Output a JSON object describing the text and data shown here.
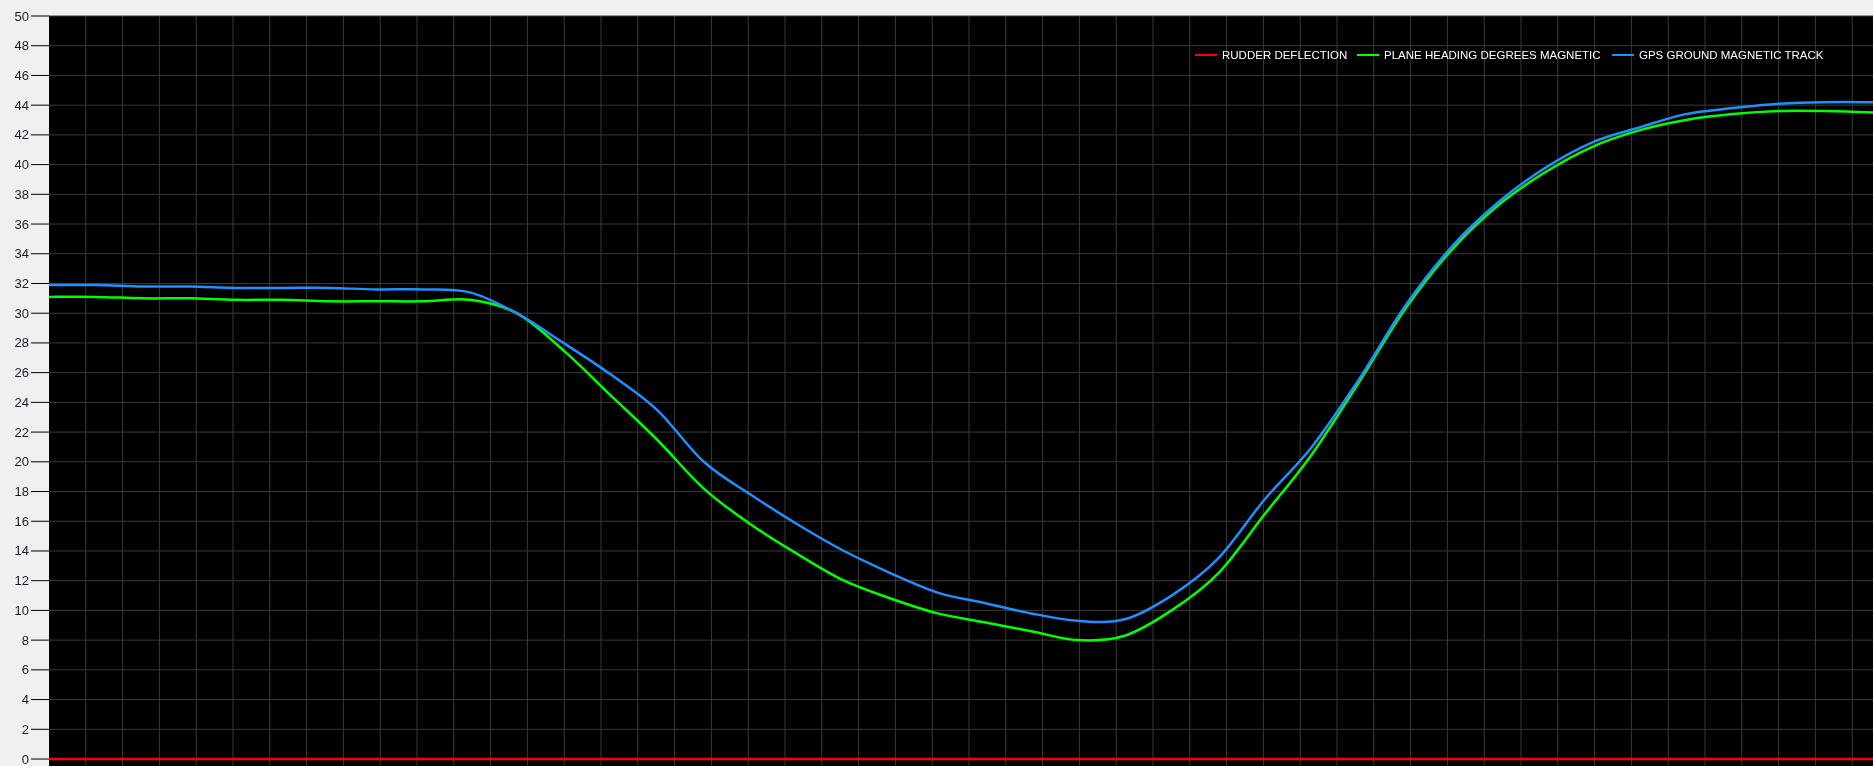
{
  "chart": {
    "chart_data": {
      "type": "line",
      "grid": true,
      "legend": true,
      "ylim": [
        -0.47,
        50
      ],
      "yticks": [
        0,
        2,
        4,
        6,
        8,
        10,
        12,
        14,
        16,
        18,
        20,
        22,
        24,
        26,
        28,
        30,
        32,
        34,
        36,
        38,
        40,
        42,
        44,
        46,
        48,
        50
      ],
      "series": [
        {
          "name": "RUDDER DEFLECTION",
          "color": "#ff0000",
          "values": [
            0,
            0,
            0,
            0,
            0,
            0,
            0,
            0,
            0,
            0,
            0,
            0,
            0,
            0,
            0,
            0,
            0,
            0,
            0,
            0,
            0,
            0,
            0,
            0,
            0,
            0,
            0,
            0,
            0,
            0,
            0,
            0,
            0,
            0,
            0,
            0,
            0,
            0,
            0,
            0
          ]
        },
        {
          "name": "PLANE HEADING DEGREES MAGNETIC",
          "color": "#00ff00",
          "values": [
            31.1,
            31.1,
            31.0,
            31.0,
            30.9,
            30.9,
            30.8,
            30.8,
            30.8,
            30.9,
            30.0,
            27.5,
            24.5,
            21.5,
            18.2,
            15.8,
            13.8,
            12.0,
            10.8,
            9.8,
            9.2,
            8.6,
            8.0,
            8.3,
            10.0,
            12.5,
            16.5,
            20.5,
            25.3,
            30.3,
            34.3,
            37.3,
            39.5,
            41.2,
            42.3,
            43.0,
            43.4,
            43.6,
            43.6,
            43.5
          ]
        },
        {
          "name": "GPS GROUND MAGNETIC TRACK",
          "color": "#1e90ff",
          "values": [
            31.9,
            31.9,
            31.8,
            31.8,
            31.7,
            31.7,
            31.7,
            31.6,
            31.6,
            31.4,
            30.0,
            28.0,
            25.9,
            23.5,
            20.0,
            17.8,
            15.8,
            14.0,
            12.5,
            11.2,
            10.5,
            9.8,
            9.3,
            9.4,
            11.0,
            13.5,
            17.5,
            21.0,
            25.5,
            30.5,
            34.5,
            37.5,
            39.8,
            41.5,
            42.5,
            43.4,
            43.8,
            44.1,
            44.2,
            44.2
          ]
        }
      ]
    }
  }
}
